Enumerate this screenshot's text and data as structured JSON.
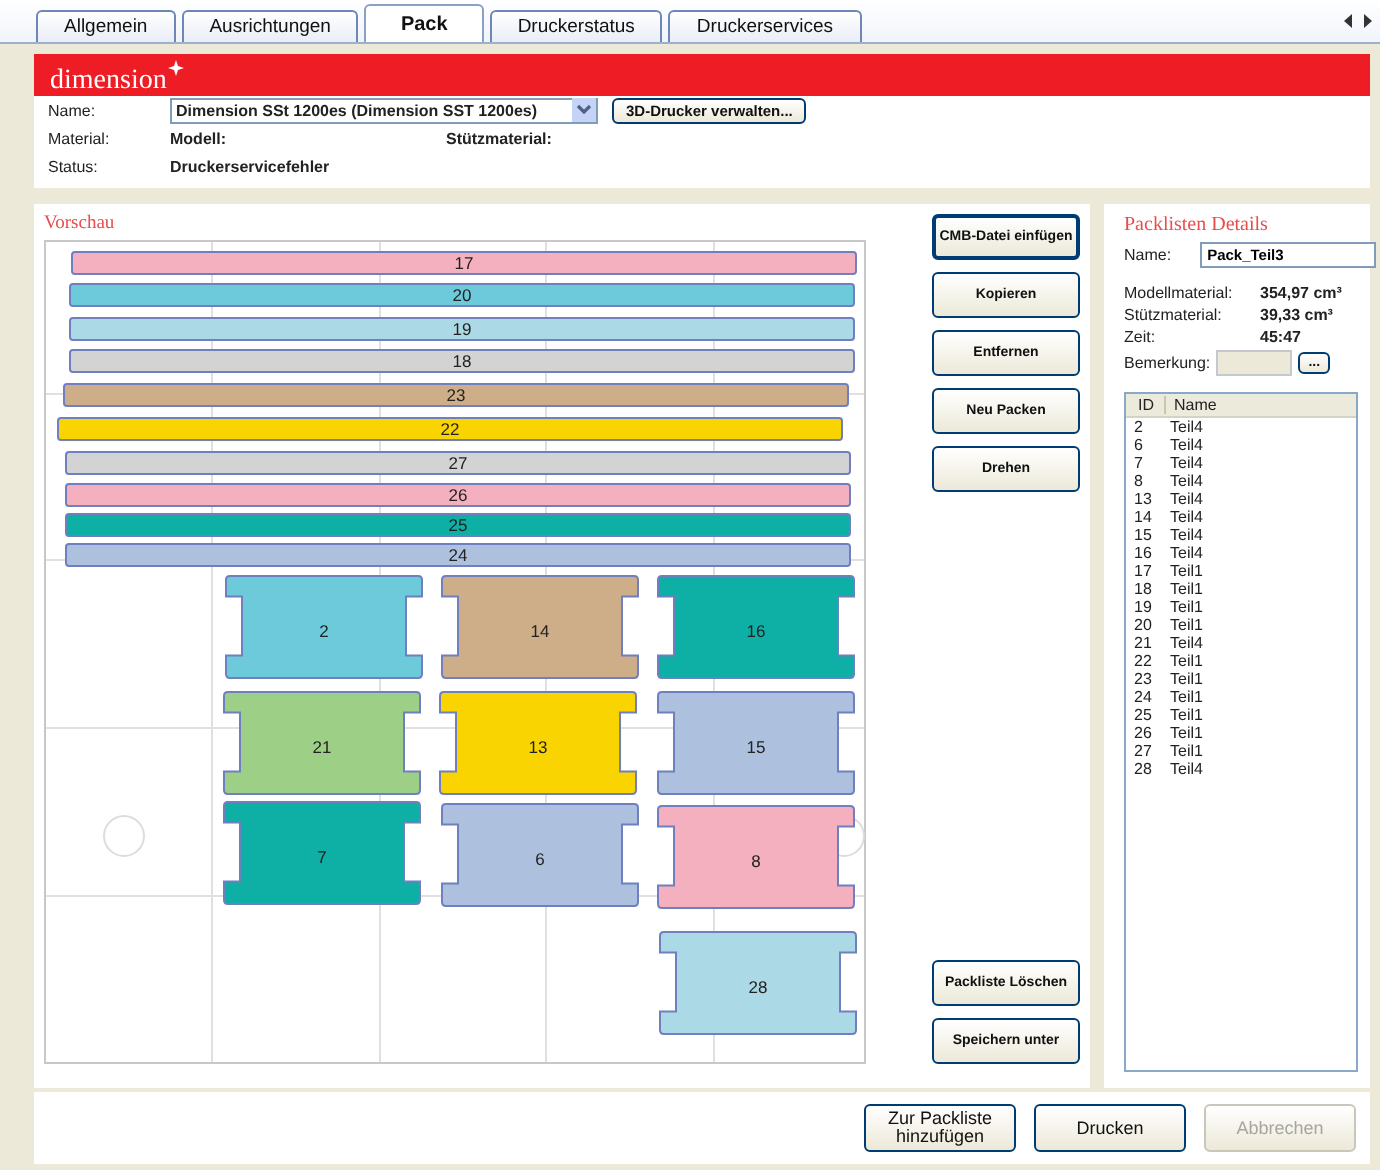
{
  "tabs": [
    {
      "label": "Allgemein",
      "selected": false
    },
    {
      "label": "Ausrichtungen",
      "selected": false
    },
    {
      "label": "Pack",
      "selected": true
    },
    {
      "label": "Druckerstatus",
      "selected": false
    },
    {
      "label": "Druckerservices",
      "selected": false
    }
  ],
  "logo": {
    "text": "dimension"
  },
  "printer": {
    "name_label": "Name:",
    "name_value": "Dimension SSt 1200es  (Dimension SST 1200es)",
    "manage_button": "3D-Drucker verwalten...",
    "material_label": "Material:",
    "model_label": "Modell:",
    "support_label": "Stützmaterial:",
    "status_label": "Status:",
    "status_value": "Druckerservicefehler"
  },
  "preview": {
    "title": "Vorschau",
    "parts": [
      {
        "label": "17",
        "kind": "bar",
        "color": "#f5b0bf"
      },
      {
        "label": "20",
        "kind": "bar",
        "color": "#6ccadb"
      },
      {
        "label": "19",
        "kind": "bar",
        "color": "#acd9e6"
      },
      {
        "label": "18",
        "kind": "bar",
        "color": "#d3d3d3"
      },
      {
        "label": "23",
        "kind": "bar",
        "color": "#cdae88"
      },
      {
        "label": "22",
        "kind": "bar",
        "color": "#f9d400"
      },
      {
        "label": "27",
        "kind": "bar",
        "color": "#d3d3d3"
      },
      {
        "label": "26",
        "kind": "bar",
        "color": "#f5b0bf"
      },
      {
        "label": "25",
        "kind": "bar",
        "color": "#0eafa5"
      },
      {
        "label": "24",
        "kind": "bar",
        "color": "#adc1de"
      },
      {
        "label": "2",
        "kind": "block",
        "color": "#6ccadb"
      },
      {
        "label": "14",
        "kind": "block",
        "color": "#cdae88"
      },
      {
        "label": "16",
        "kind": "block",
        "color": "#0eafa5"
      },
      {
        "label": "21",
        "kind": "block",
        "color": "#9dcf87"
      },
      {
        "label": "13",
        "kind": "block",
        "color": "#f9d400"
      },
      {
        "label": "15",
        "kind": "block",
        "color": "#adc1de"
      },
      {
        "label": "7",
        "kind": "block",
        "color": "#0eafa5"
      },
      {
        "label": "6",
        "kind": "block",
        "color": "#adc1de"
      },
      {
        "label": "8",
        "kind": "block",
        "color": "#f5b0bf"
      },
      {
        "label": "28",
        "kind": "block",
        "color": "#acd9e6"
      }
    ]
  },
  "actions_top": [
    "CMB-Datei einfügen",
    "Kopieren",
    "Entfernen",
    "Neu Packen",
    "Drehen"
  ],
  "actions_bottom": [
    "Packliste Löschen",
    "Speichern unter"
  ],
  "details": {
    "title": "Packlisten Details",
    "name_label": "Name:",
    "name_value": "Pack_Teil3",
    "stats": [
      {
        "label": "Modellmaterial:",
        "value": "354,97 cm³"
      },
      {
        "label": "Stützmaterial:",
        "value": "39,33 cm³"
      },
      {
        "label": "Zeit:",
        "value": "45:47"
      }
    ],
    "remark_label": "Bemerkung:",
    "remark_button": "...",
    "columns": [
      "ID",
      "Name"
    ],
    "rows": [
      {
        "id": "2",
        "name": "Teil4"
      },
      {
        "id": "6",
        "name": "Teil4"
      },
      {
        "id": "7",
        "name": "Teil4"
      },
      {
        "id": "8",
        "name": "Teil4"
      },
      {
        "id": "13",
        "name": "Teil4"
      },
      {
        "id": "14",
        "name": "Teil4"
      },
      {
        "id": "15",
        "name": "Teil4"
      },
      {
        "id": "16",
        "name": "Teil4"
      },
      {
        "id": "17",
        "name": "Teil1"
      },
      {
        "id": "18",
        "name": "Teil1"
      },
      {
        "id": "19",
        "name": "Teil1"
      },
      {
        "id": "20",
        "name": "Teil1"
      },
      {
        "id": "21",
        "name": "Teil4"
      },
      {
        "id": "22",
        "name": "Teil1"
      },
      {
        "id": "23",
        "name": "Teil1"
      },
      {
        "id": "24",
        "name": "Teil1"
      },
      {
        "id": "25",
        "name": "Teil1"
      },
      {
        "id": "26",
        "name": "Teil1"
      },
      {
        "id": "27",
        "name": "Teil1"
      },
      {
        "id": "28",
        "name": "Teil4"
      }
    ]
  },
  "footer": [
    {
      "label": "Zur Packliste hinzufügen",
      "disabled": false
    },
    {
      "label": "Drucken",
      "disabled": false
    },
    {
      "label": "Abbrechen",
      "disabled": true
    }
  ]
}
